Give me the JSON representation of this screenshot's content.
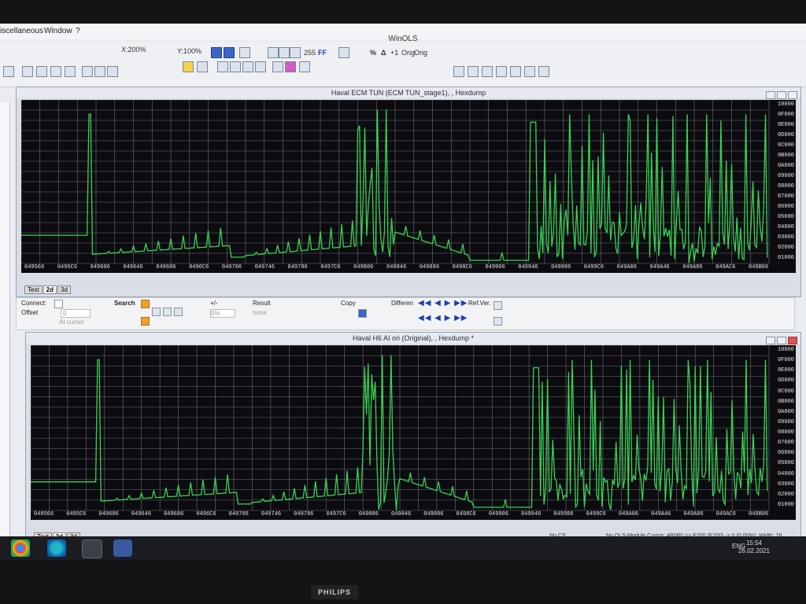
{
  "menu": {
    "items": [
      "iscellaneous",
      "Window",
      "?"
    ]
  },
  "app_title": "WinOLS",
  "toolbar": {
    "zoom_x": "X:200%",
    "zoom_y": "Y:100%",
    "labels": [
      "255",
      "FF",
      "Orig",
      "Orig"
    ]
  },
  "panel_top": {
    "title": "Haval ECM TUN (ECM TUN_stage1), , Hexdump",
    "y_labels": [
      "10000",
      "0F000",
      "0E000",
      "0D000",
      "0C000",
      "0B000",
      "0A000",
      "09000",
      "08000",
      "07000",
      "06000",
      "05000",
      "04000",
      "03000",
      "02000",
      "01000"
    ],
    "x_labels": [
      "049566",
      "0495C6",
      "049606",
      "049646",
      "049686",
      "0496C6",
      "049706",
      "049746",
      "049786",
      "0497C6",
      "049806",
      "049846",
      "049886",
      "0498C6",
      "049906",
      "049946",
      "049986",
      "0499C6",
      "049A06",
      "049A46",
      "049A86",
      "049AC6",
      "049B06"
    ],
    "tabs": [
      "Text",
      "2d",
      "3d"
    ]
  },
  "panel_bottom": {
    "title": "Haval H6 AI ori (Original), , Hexdump *",
    "y_labels": [
      "10000",
      "0F000",
      "0E000",
      "0D000",
      "0C000",
      "0B000",
      "0A000",
      "09000",
      "08000",
      "07000",
      "06000",
      "05000",
      "04000",
      "03000",
      "02000",
      "01000"
    ],
    "x_labels": [
      "049566",
      "0495C6",
      "049606",
      "049646",
      "049686",
      "0496C6",
      "049706",
      "049746",
      "049786",
      "0497C6",
      "049806",
      "049846",
      "049886",
      "0498C6",
      "049906",
      "049946",
      "049986",
      "0499C6",
      "049A06",
      "049A46",
      "049A86",
      "049AC6",
      "049B06"
    ],
    "tabs": [
      "Text",
      "2d",
      "3d"
    ]
  },
  "midbar": {
    "connect_label": "Connect:",
    "offset_label": "Offset",
    "offset_value": "0",
    "at_cursor": "At cursor",
    "search_label": "Search",
    "plusminus_label": "+/-",
    "percent_value": "0%",
    "result_label": "Result",
    "result_value": "none",
    "copy_label": "Copy",
    "differences_label": "Differen",
    "ref_ver_label": "Ref.Ver."
  },
  "status": {
    "cs_label": "No CS",
    "cursor_text": "No OLS-Module   Cursor: 4B0B0 => E200 (E200) -> 0 (0,00%);  Width: 16"
  },
  "clock": {
    "time": "15:54",
    "date": "26.02.2021",
    "lang": "ENG"
  },
  "monitor_brand": "PHILIPS",
  "colors": {
    "trace": "#39d353",
    "grid": "#6e6e78",
    "background": "#0b0b10"
  }
}
